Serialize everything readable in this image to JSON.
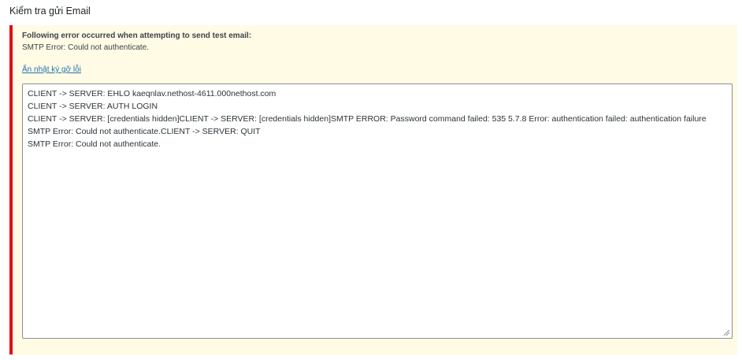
{
  "section": {
    "title": "Kiểm tra gửi Email"
  },
  "notice": {
    "heading": "Following error occurred when attempting to send test email:",
    "message": "SMTP Error: Could not authenticate.",
    "toggle_label": "Ẩn nhật ký gỡ lỗi",
    "accent_color": "#e50914",
    "background_color": "#fffbe5"
  },
  "log": {
    "lines": [
      "CLIENT -> SERVER: EHLO kaeqnlav.nethost-4611.000nethost.com",
      "CLIENT -> SERVER: AUTH LOGIN",
      "CLIENT -> SERVER: [credentials hidden]CLIENT -> SERVER: [credentials hidden]SMTP ERROR: Password command failed: 535 5.7.8 Error: authentication failed: authentication failure",
      "SMTP Error: Could not authenticate.CLIENT -> SERVER: QUIT",
      "SMTP Error: Could not authenticate."
    ]
  }
}
